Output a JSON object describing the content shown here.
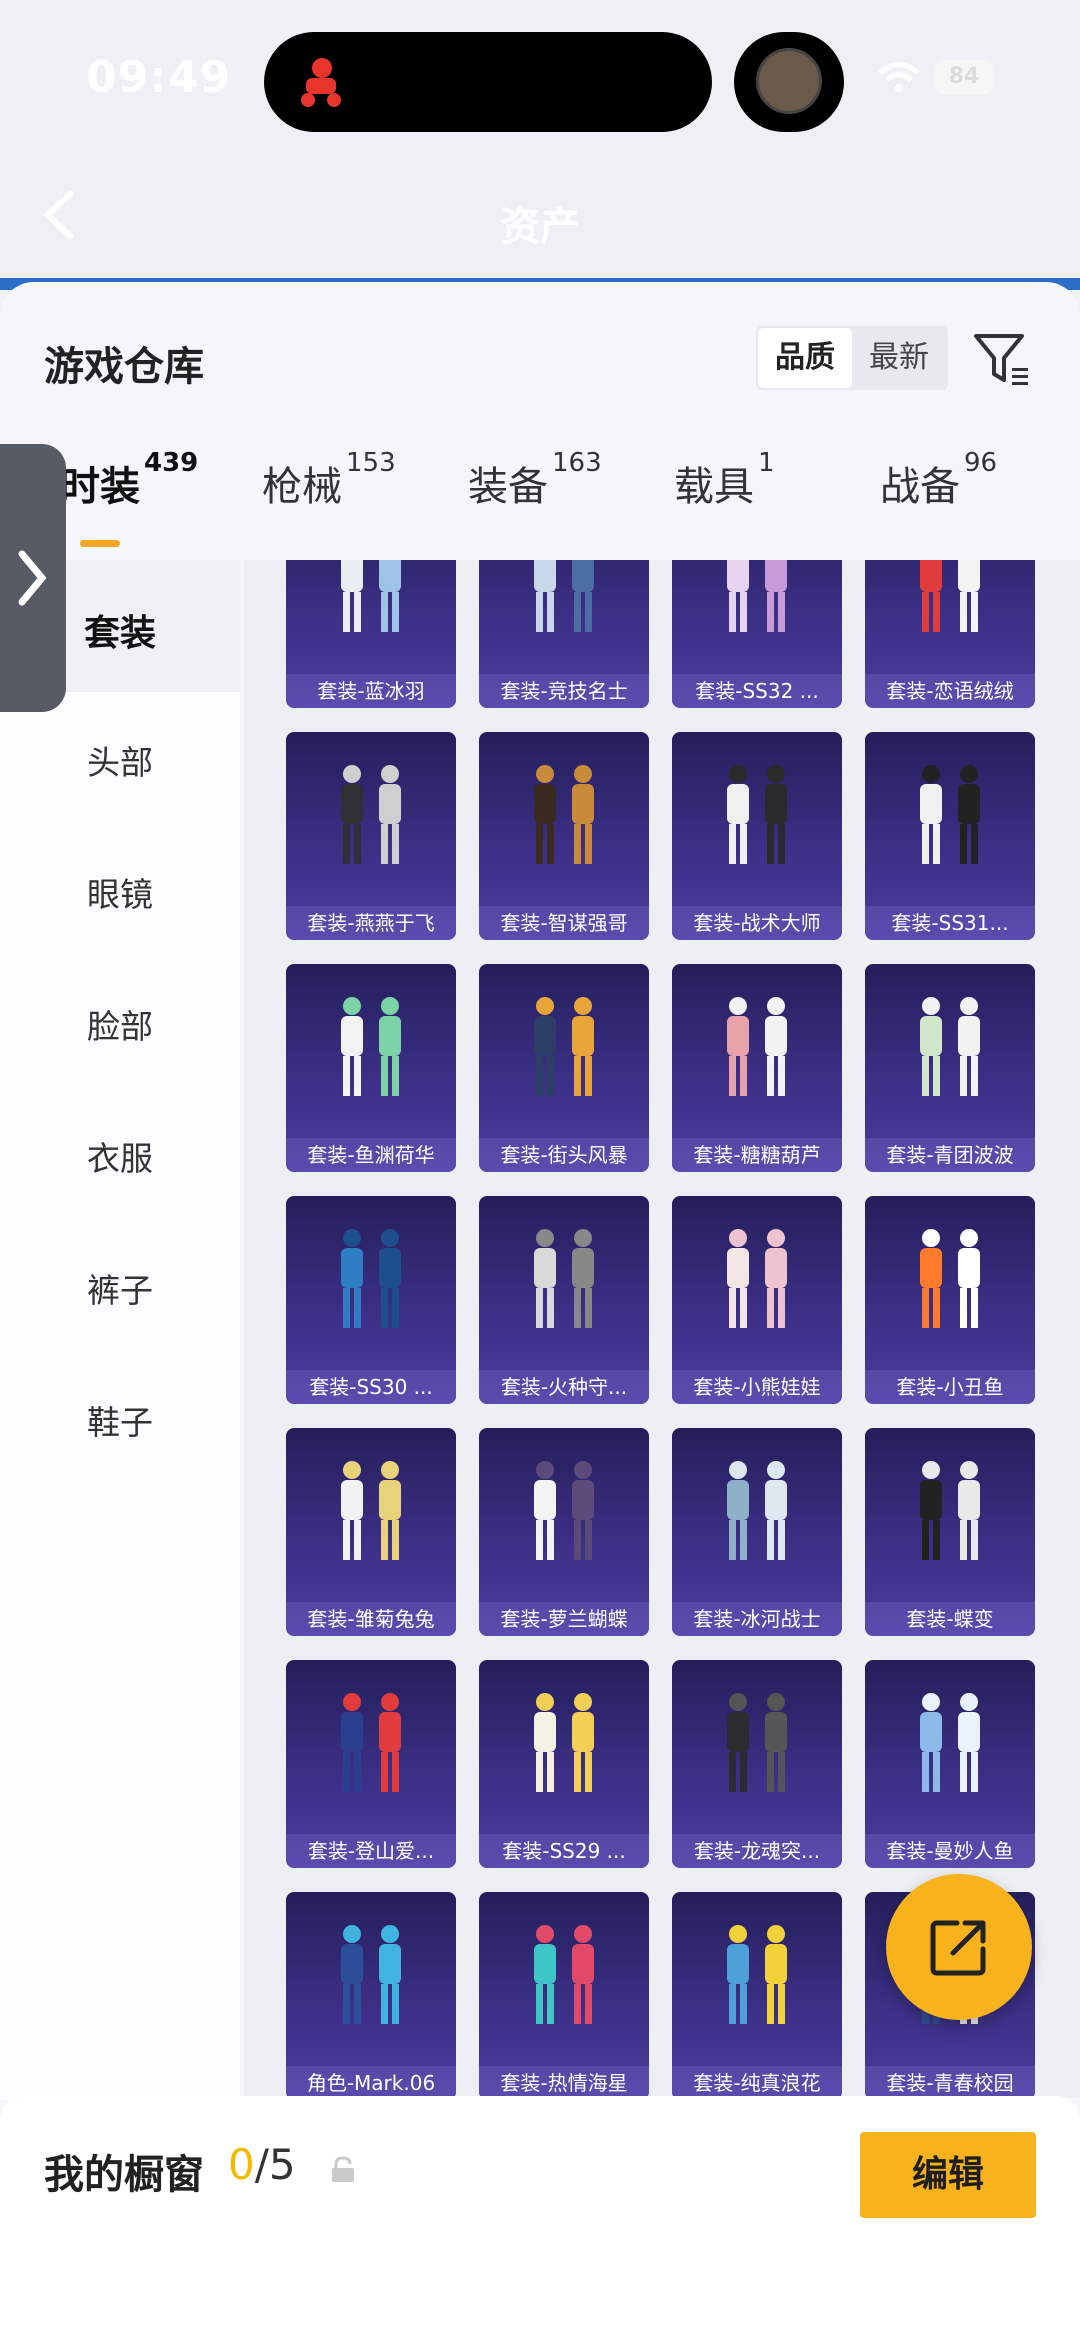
{
  "status_bar": {
    "time": "09:49",
    "battery": "84"
  },
  "header": {
    "title": "资产"
  },
  "panel": {
    "title": "游戏仓库",
    "sort": {
      "quality": "品质",
      "latest": "最新"
    }
  },
  "tabs": [
    {
      "label": "时装",
      "count": "439",
      "active": true
    },
    {
      "label": "枪械",
      "count": "153",
      "active": false
    },
    {
      "label": "装备",
      "count": "163",
      "active": false
    },
    {
      "label": "载具",
      "count": "1",
      "active": false
    },
    {
      "label": "战备",
      "count": "96",
      "active": false
    }
  ],
  "sidebar": [
    {
      "label": "套装",
      "selected": true
    },
    {
      "label": "头部",
      "selected": false
    },
    {
      "label": "眼镜",
      "selected": false
    },
    {
      "label": "脸部",
      "selected": false
    },
    {
      "label": "衣服",
      "selected": false
    },
    {
      "label": "裤子",
      "selected": false
    },
    {
      "label": "鞋子",
      "selected": false
    }
  ],
  "items": [
    {
      "label": "套装-蓝冰羽"
    },
    {
      "label": "套装-竞技名士"
    },
    {
      "label": "套装-SS32 ..."
    },
    {
      "label": "套装-恋语绒绒"
    },
    {
      "label": "套装-燕燕于飞"
    },
    {
      "label": "套装-智谋强哥"
    },
    {
      "label": "套装-战术大师"
    },
    {
      "label": "套装-SS31..."
    },
    {
      "label": "套装-鱼渊荷华"
    },
    {
      "label": "套装-街头风暴"
    },
    {
      "label": "套装-糖糖葫芦"
    },
    {
      "label": "套装-青团波波"
    },
    {
      "label": "套装-SS30 ..."
    },
    {
      "label": "套装-火种守..."
    },
    {
      "label": "套装-小熊娃娃"
    },
    {
      "label": "套装-小丑鱼"
    },
    {
      "label": "套装-雏菊兔兔"
    },
    {
      "label": "套装-萝兰蝴蝶"
    },
    {
      "label": "套装-冰河战士"
    },
    {
      "label": "套装-蝶变"
    },
    {
      "label": "套装-登山爱..."
    },
    {
      "label": "套装-SS29 ..."
    },
    {
      "label": "套装-龙魂突..."
    },
    {
      "label": "套装-曼妙人鱼"
    },
    {
      "label": "角色-Mark.06"
    },
    {
      "label": "套装-热情海星"
    },
    {
      "label": "套装-纯真浪花"
    },
    {
      "label": "套装-青春校园"
    }
  ],
  "showcase": {
    "label": "我的橱窗",
    "current": "0",
    "total": "/5",
    "edit_label": "编辑"
  },
  "colors": {
    "accent": "#f7b21c",
    "card_bg": "#3c2f86",
    "highlight_count": "#f5b800"
  },
  "icons": [
    "back-chevron-icon",
    "filter-icon",
    "lock-icon",
    "share-icon",
    "drawer-chevron-icon"
  ]
}
